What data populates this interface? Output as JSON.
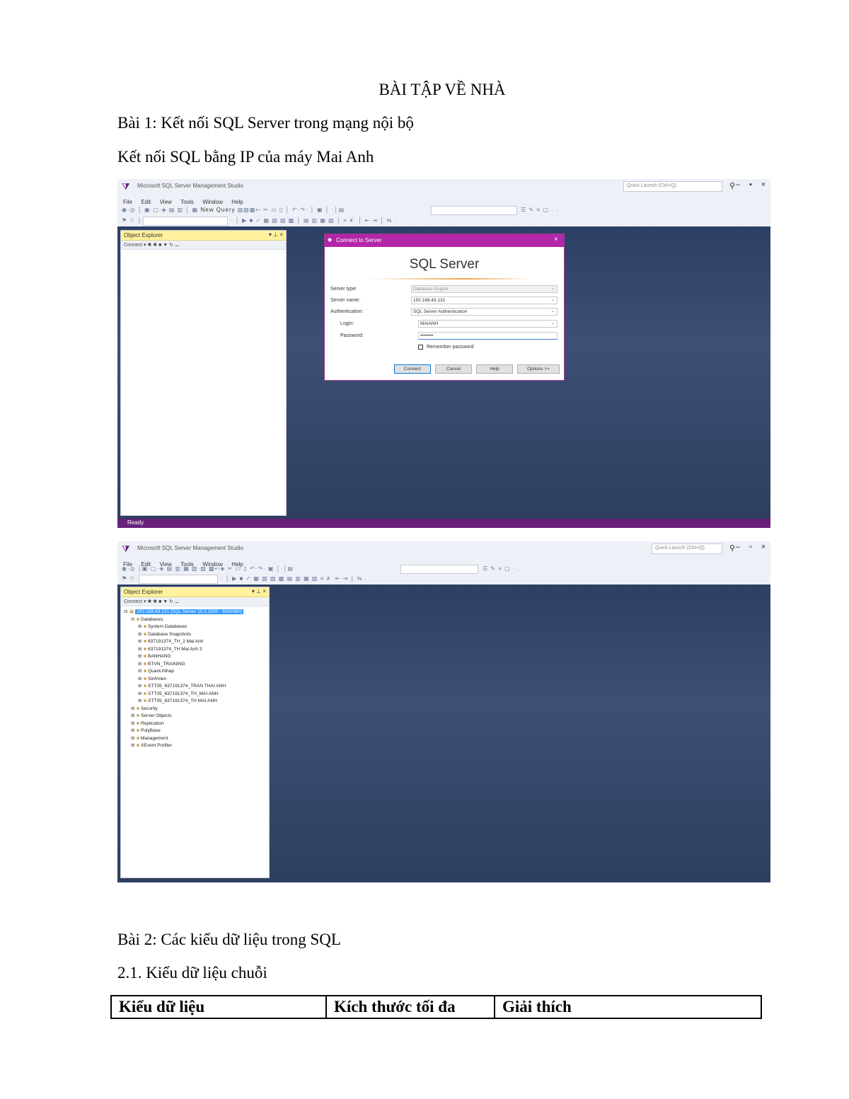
{
  "document": {
    "title": "BÀI TẬP VỀ NHÀ",
    "heading1": "Bài 1: Kết nối SQL Server trong mạng nội bộ",
    "subheading1": "Kết nối SQL bằng IP của máy Mai Anh",
    "heading2": "Bài 2: Các kiểu dữ liệu trong SQL",
    "subheading2": "2.1. Kiểu dữ liệu chuỗi"
  },
  "screenshot1": {
    "app_title": "Microsoft SQL Server Management Studio",
    "quick_launch_placeholder": "Quick Launch (Ctrl+Q)",
    "menu": [
      "File",
      "Edit",
      "View",
      "Tools",
      "Window",
      "Help"
    ],
    "toolbar_new_query": "New Query",
    "explorer_title": "Object Explorer",
    "explorer_controls": "▾ ⊥ ×",
    "explorer_toolbar": "Connect ▾  ✱  ✱  ■  ▼  ↻  ⚊",
    "status": "Ready",
    "dialog": {
      "caption": "Connect to Server",
      "heading": "SQL Server",
      "fields": [
        {
          "label": "Server type:",
          "value": "Database Engine"
        },
        {
          "label": "Server name:",
          "value": "192.168.43.131"
        },
        {
          "label": "Authentication:",
          "value": "SQL Server Authentication"
        },
        {
          "label": "Login:",
          "value": "MAIANH"
        },
        {
          "label": "Password:",
          "value": "••••••••"
        }
      ],
      "remember": "Remember password",
      "buttons": [
        "Connect",
        "Cancel",
        "Help",
        "Options >>"
      ]
    }
  },
  "screenshot2": {
    "app_title": "Microsoft SQL Server Management Studio",
    "quick_launch_placeholder": "Quick Launch (Ctrl+Q)",
    "menu": [
      "File",
      "Edit",
      "View",
      "Tools",
      "Window",
      "Help"
    ],
    "explorer_title": "Object Explorer",
    "explorer_controls": "▾ ⊥ ×",
    "explorer_toolbar": "Connect ▾  ✱  ✱  ■  ▼  ↻  ⚊",
    "tree": [
      {
        "text": "192.168.43.131 (SQL Server 15.0.2000 - MAIANH)",
        "indent": 0,
        "exp": "⊟",
        "selected": true
      },
      {
        "text": "Databases",
        "indent": 1,
        "exp": "⊟"
      },
      {
        "text": "System Databases",
        "indent": 2,
        "exp": "⊞"
      },
      {
        "text": "Database Snapshots",
        "indent": 2,
        "exp": "⊞"
      },
      {
        "text": "637191374_TH_2 Mai Anh",
        "indent": 2,
        "exp": "⊞"
      },
      {
        "text": "637191374_TH Mai Anh 3",
        "indent": 2,
        "exp": "⊞"
      },
      {
        "text": "BANHANG",
        "indent": 2,
        "exp": "⊞"
      },
      {
        "text": "BTVN_TRAINING",
        "indent": 2,
        "exp": "⊞"
      },
      {
        "text": "QuanLiNhap",
        "indent": 2,
        "exp": "⊞"
      },
      {
        "text": "SinhVien",
        "indent": 2,
        "exp": "⊞"
      },
      {
        "text": "STT05_637191374_TRAN THAI ANH",
        "indent": 2,
        "exp": "⊞"
      },
      {
        "text": "STT05_637191374_TH_MAI ANH",
        "indent": 2,
        "exp": "⊞"
      },
      {
        "text": "STT05_637191374_TH MAI ANH",
        "indent": 2,
        "exp": "⊞"
      },
      {
        "text": "Security",
        "indent": 1,
        "exp": "⊞"
      },
      {
        "text": "Server Objects",
        "indent": 1,
        "exp": "⊞"
      },
      {
        "text": "Replication",
        "indent": 1,
        "exp": "⊞"
      },
      {
        "text": "PolyBase",
        "indent": 1,
        "exp": "⊞"
      },
      {
        "text": "Management",
        "indent": 1,
        "exp": "⊞"
      },
      {
        "text": "XEvent Profiler",
        "indent": 1,
        "exp": "⊞"
      }
    ]
  },
  "table": {
    "headers": [
      "Kiểu dữ liệu",
      "Kích thước tối đa",
      "Giải thích"
    ]
  },
  "colors": {
    "ssms_accent": "#68217a",
    "dialog_bar": "#b426a8",
    "workspace": "#3c5075",
    "explorer_header": "#fff19d"
  }
}
